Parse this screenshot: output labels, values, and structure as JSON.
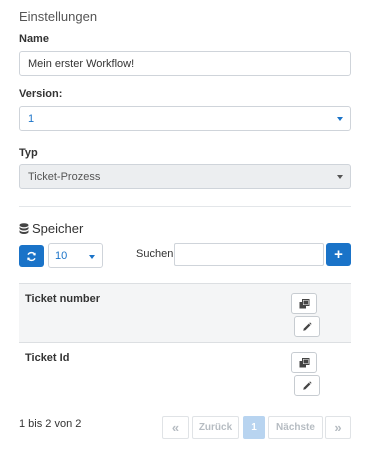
{
  "header": {
    "title": "Einstellungen"
  },
  "form": {
    "name_label": "Name",
    "name_value": "Mein erster Workflow!",
    "version_label": "Version:",
    "version_value": "1",
    "typ_label": "Typ",
    "typ_value": "Ticket-Prozess"
  },
  "storage": {
    "title": "Speicher",
    "page_size": "10",
    "search_label": "Suchen",
    "search_value": "",
    "add_symbol": "+"
  },
  "table": {
    "rows": [
      {
        "label": "Ticket number"
      },
      {
        "label": "Ticket Id"
      }
    ]
  },
  "pagination": {
    "info": "1 bis 2 von 2",
    "first": "«",
    "prev": "Zurück",
    "current": "1",
    "next": "Nächste",
    "last": "»"
  },
  "colors": {
    "accent": "#1a73c8",
    "border": "#cfd4da",
    "disabled_bg": "#eceef0"
  },
  "icons": {
    "refresh": "refresh-icon",
    "database": "database-icon",
    "copy": "copy-icon",
    "edit": "pencil-icon"
  }
}
